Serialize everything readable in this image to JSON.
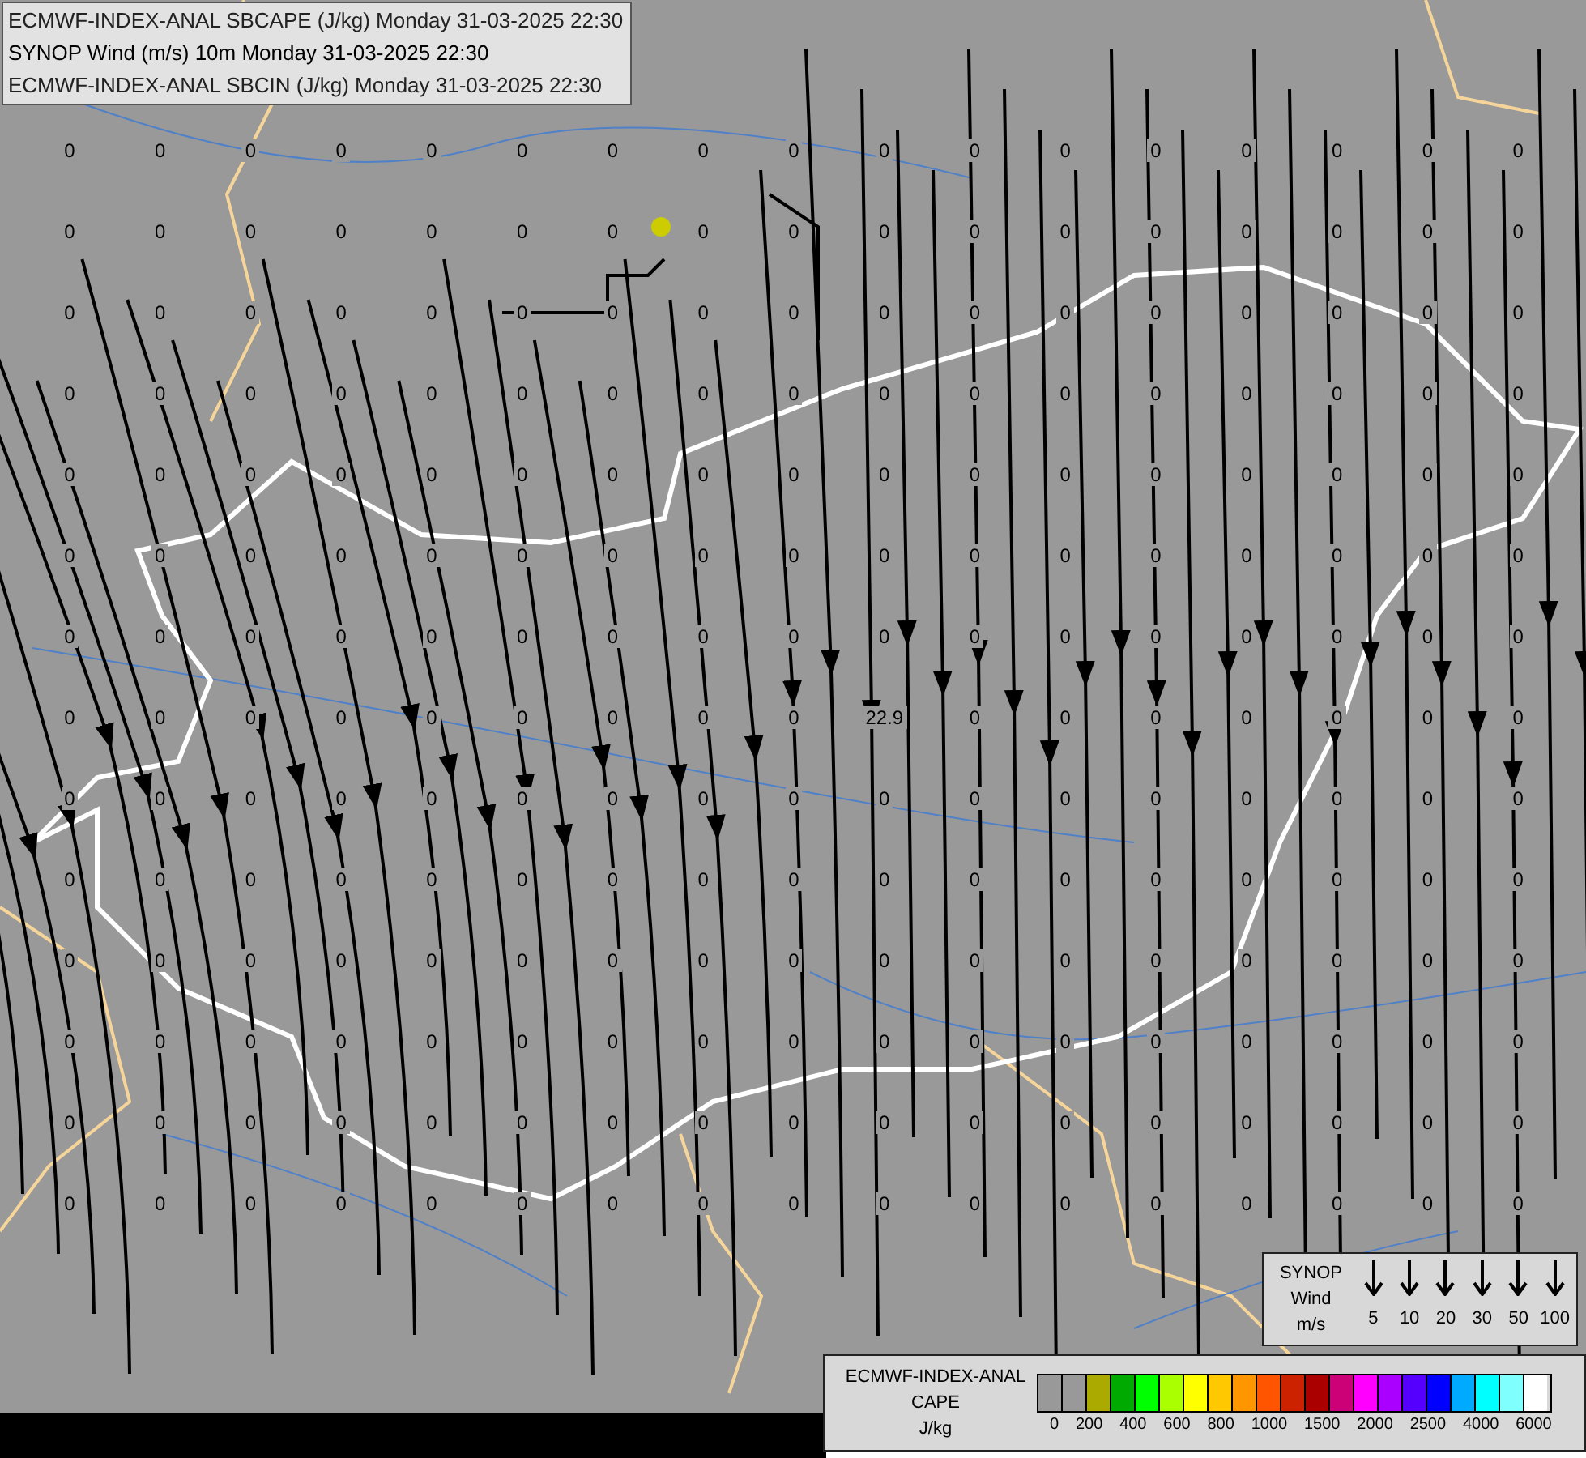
{
  "title_box": {
    "lines": [
      "ECMWF-INDEX-ANAL SBCAPE (J/kg) Monday 31-03-2025 22:30",
      "SYNOP Wind (m/s) 10m Monday 31-03-2025 22:30",
      "ECMWF-INDEX-ANAL SBCIN (J/kg) Monday 31-03-2025 22:30"
    ]
  },
  "map": {
    "value_rows": [
      [
        "0",
        "0",
        "0",
        "0",
        "0",
        "0",
        "0",
        "0",
        "0",
        "0",
        "0",
        "0",
        "0",
        "0",
        "0",
        "0",
        "0"
      ],
      [
        "0",
        "0",
        "0",
        "0",
        "0",
        "0",
        "0",
        "0",
        "0",
        "0",
        "0",
        "0",
        "0",
        "0",
        "0",
        "0",
        "0"
      ],
      [
        "0",
        "0",
        "0",
        "0",
        "0",
        "0",
        "0",
        "0",
        "0",
        "0",
        "0",
        "0",
        "0",
        "0",
        "0",
        "0",
        "0"
      ],
      [
        "0",
        "0",
        "0",
        "0",
        "0",
        "0",
        "0",
        "0",
        "0",
        "0",
        "0",
        "0",
        "0",
        "0",
        "0",
        "0",
        "0"
      ],
      [
        "0",
        "0",
        "0",
        "0",
        "0",
        "0",
        "0",
        "0",
        "0",
        "0",
        "0",
        "0",
        "0",
        "0",
        "0",
        "0",
        "0"
      ],
      [
        "0",
        "0",
        "0",
        "0",
        "0",
        "0",
        "0",
        "0",
        "0",
        "0",
        "0",
        "0",
        "0",
        "0",
        "0",
        "0",
        "0"
      ],
      [
        "0",
        "0",
        "0",
        "0",
        "0",
        "0",
        "0",
        "0",
        "0",
        "0",
        "0",
        "0",
        "0",
        "0",
        "0",
        "0",
        "0"
      ],
      [
        "0",
        "0",
        "0",
        "0",
        "0",
        "0",
        "0",
        "0",
        "0",
        "22.9",
        "0",
        "0",
        "0",
        "0",
        "0",
        "0",
        "0"
      ],
      [
        "0",
        "0",
        "0",
        "0",
        "0",
        "0",
        "0",
        "0",
        "0",
        "0",
        "0",
        "0",
        "0",
        "0",
        "0",
        "0",
        "0"
      ],
      [
        "0",
        "0",
        "0",
        "0",
        "0",
        "0",
        "0",
        "0",
        "0",
        "0",
        "0",
        "0",
        "0",
        "0",
        "0",
        "0",
        "0"
      ],
      [
        "0",
        "0",
        "0",
        "0",
        "0",
        "0",
        "0",
        "0",
        "0",
        "0",
        "0",
        "0",
        "0",
        "0",
        "0",
        "0",
        "0"
      ],
      [
        "0",
        "0",
        "0",
        "0",
        "0",
        "0",
        "0",
        "0",
        "0",
        "0",
        "0",
        "0",
        "0",
        "0",
        "0",
        "0",
        "0"
      ],
      [
        "0",
        "0",
        "0",
        "0",
        "0",
        "0",
        "0",
        "0",
        "0",
        "0",
        "0",
        "0",
        "0",
        "0",
        "0",
        "0",
        "0"
      ],
      [
        "0",
        "0",
        "0",
        "0",
        "0",
        "0",
        "0",
        "0",
        "0",
        "0",
        "0",
        "0",
        "0",
        "0",
        "0",
        "0",
        "0"
      ]
    ]
  },
  "wind_legend": {
    "title": [
      "SYNOP",
      "Wind",
      "m/s"
    ],
    "speeds": [
      "5",
      "10",
      "20",
      "30",
      "50",
      "100"
    ]
  },
  "cape_legend": {
    "title": [
      "ECMWF-INDEX-ANAL",
      "CAPE",
      "J/kg"
    ],
    "swatches": [
      {
        "color": "#999999"
      },
      {
        "color": "#999999"
      },
      {
        "color": "#aaaa00"
      },
      {
        "color": "#00aa00"
      },
      {
        "color": "#00ff00"
      },
      {
        "color": "#aaff00"
      },
      {
        "color": "#ffff00"
      },
      {
        "color": "#ffc800"
      },
      {
        "color": "#ff9600"
      },
      {
        "color": "#ff5500"
      },
      {
        "color": "#cc2200"
      },
      {
        "color": "#aa0000"
      },
      {
        "color": "#cc0077"
      },
      {
        "color": "#ff00ff"
      },
      {
        "color": "#aa00ff"
      },
      {
        "color": "#5500ff"
      },
      {
        "color": "#0000ff"
      },
      {
        "color": "#00aaff"
      },
      {
        "color": "#00ffff"
      },
      {
        "color": "#80ffff"
      },
      {
        "color": "#ffffff"
      }
    ],
    "labels": [
      "0",
      "200",
      "400",
      "600",
      "800",
      "1000",
      "1500",
      "2000",
      "2500",
      "4000",
      "6000"
    ]
  }
}
